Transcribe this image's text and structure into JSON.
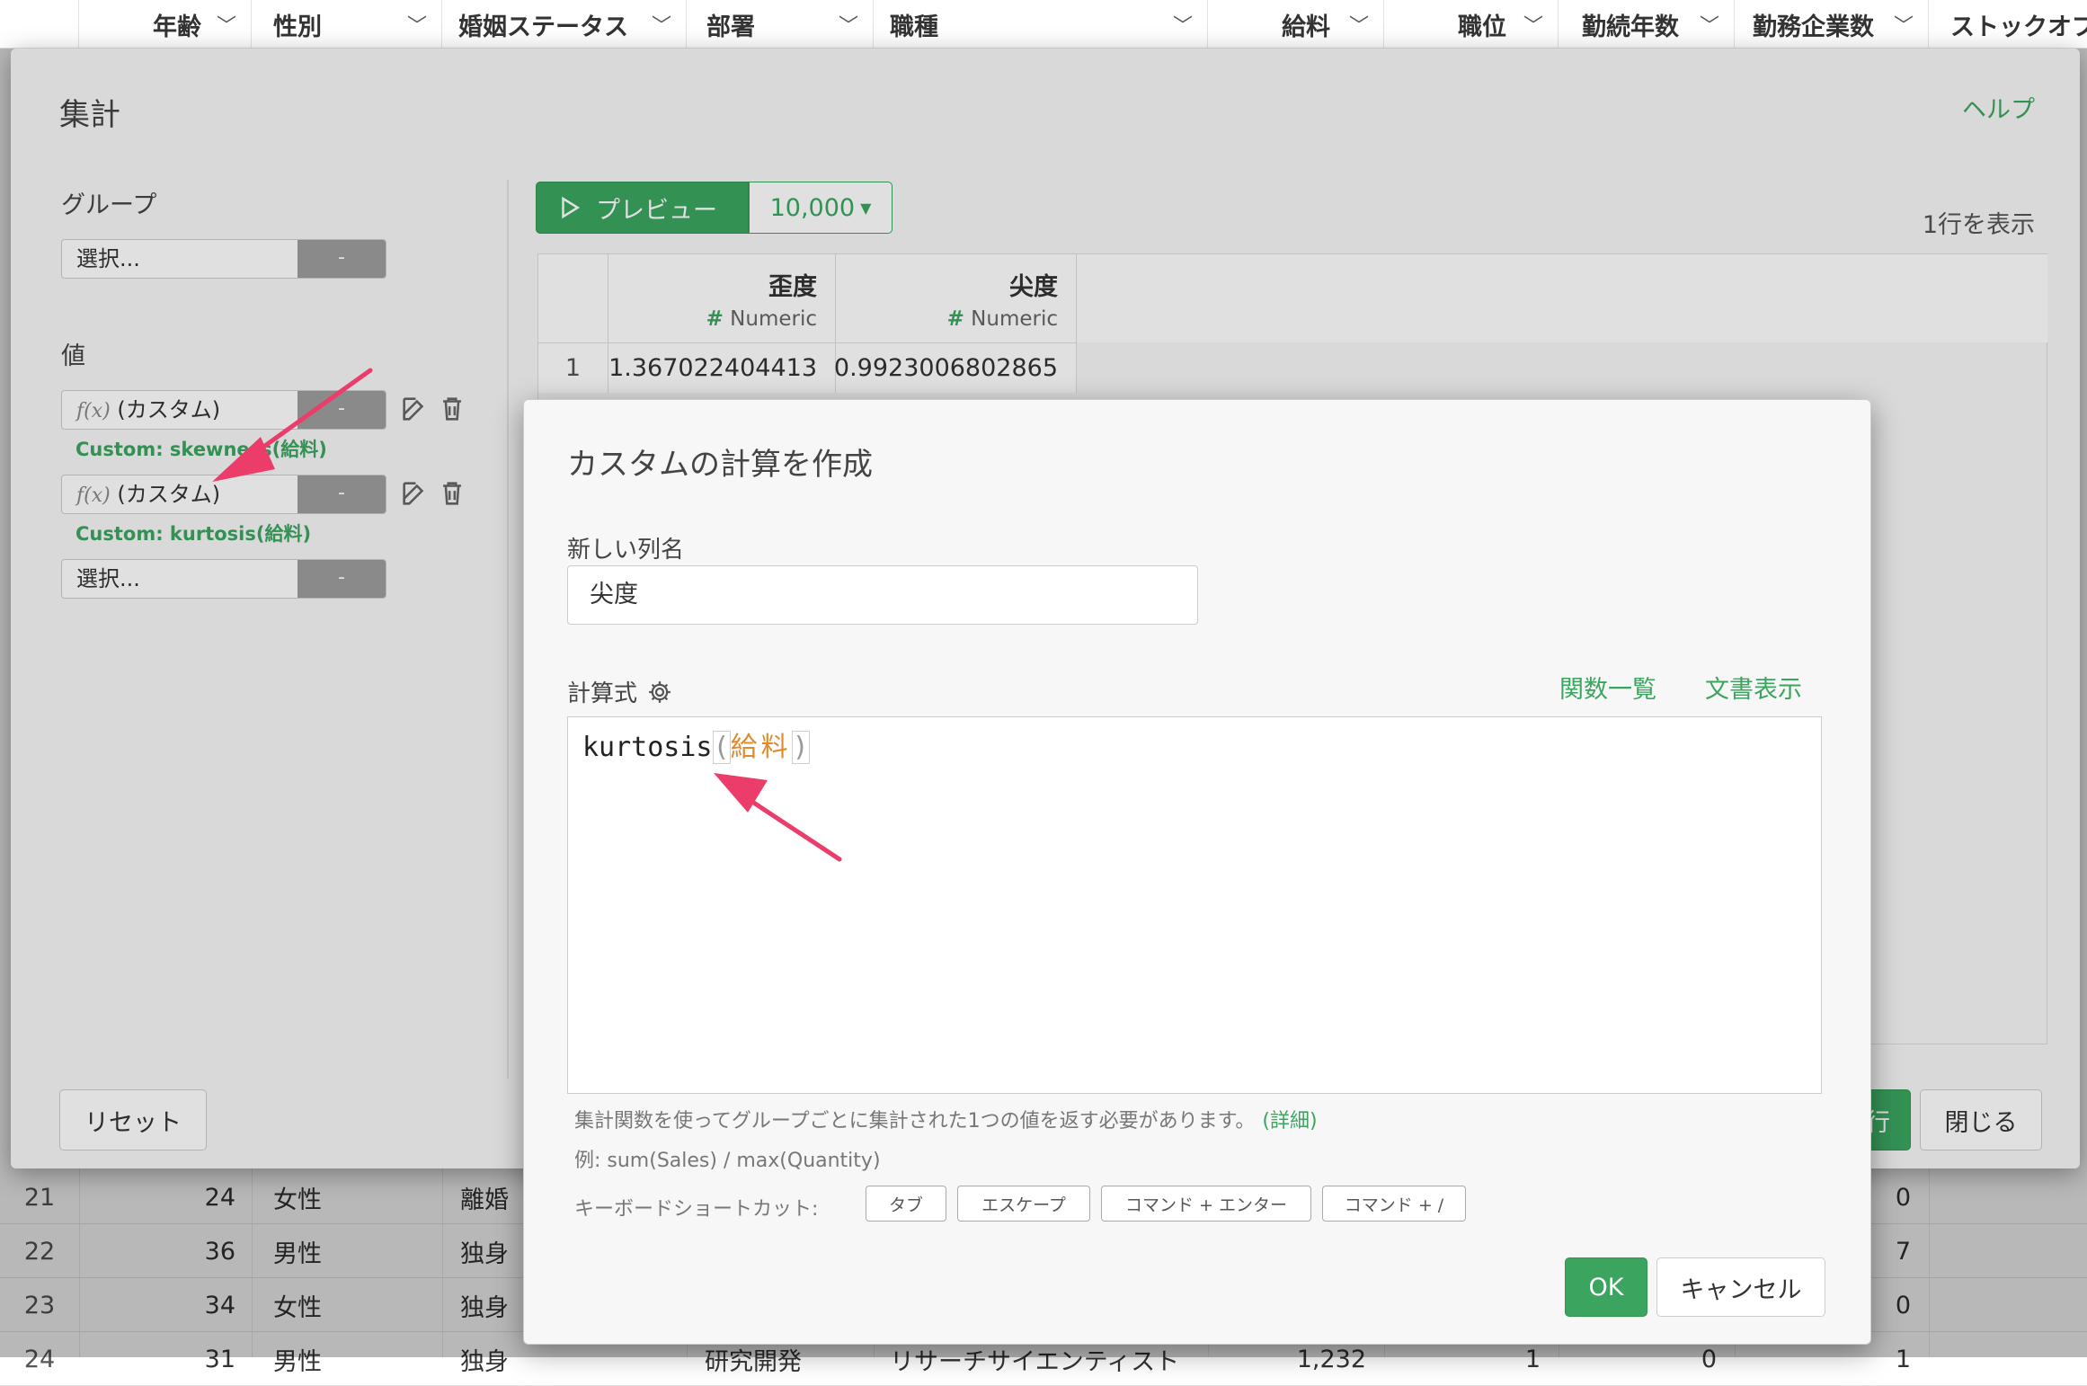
{
  "background_table": {
    "columns": [
      "年齢",
      "性別",
      "婚姻ステータス",
      "部署",
      "職種",
      "給料",
      "職位",
      "勤続年数",
      "勤務企業数",
      "ストックオプ"
    ],
    "rows": [
      {
        "num": "21",
        "age": "24",
        "sex": "女性",
        "marital": "離婚",
        "extra": "0"
      },
      {
        "num": "22",
        "age": "36",
        "sex": "男性",
        "marital": "独身",
        "extra": "7"
      },
      {
        "num": "23",
        "age": "34",
        "sex": "女性",
        "marital": "独身",
        "extra": "0"
      },
      {
        "num": "24",
        "age": "31",
        "sex": "男性",
        "marital": "独身",
        "dept": "研究開発",
        "job": "リサーチサイエンティスト",
        "salary": "1,232",
        "rank": "1",
        "years": "0",
        "extra": "1"
      }
    ]
  },
  "aggregate_dialog": {
    "title": "集計",
    "help_link": "ヘルプ",
    "group_label": "グループ",
    "group_select_placeholder": "選択...",
    "minus_label": "-",
    "value_label": "値",
    "values": [
      {
        "fx": "f(x)",
        "label": "(カスタム)",
        "caption": "Custom: skewness(給料)"
      },
      {
        "fx": "f(x)",
        "label": "(カスタム)",
        "caption": "Custom: kurtosis(給料)"
      }
    ],
    "value_select_placeholder": "選択...",
    "preview_button": "プレビュー",
    "rows_dropdown": "10,000",
    "rows_info": "1行を表示",
    "result_table": {
      "columns": [
        {
          "name": "歪度",
          "type": "Numeric"
        },
        {
          "name": "尖度",
          "type": "Numeric"
        }
      ],
      "rows": [
        {
          "index": "1",
          "values": [
            "1.367022404413",
            "0.9923006802865"
          ]
        }
      ]
    },
    "reset_button": "リセット",
    "run_button_partial": "行",
    "close_button": "閉じる"
  },
  "custom_dialog": {
    "title": "カスタムの計算を作成",
    "new_column_label": "新しい列名",
    "new_column_value": "尖度",
    "formula_label": "計算式",
    "functions_link": "関数一覧",
    "docs_link": "文書表示",
    "formula": {
      "func": "kurtosis",
      "open": "(",
      "arg": "給料",
      "close": ")"
    },
    "hint_text": "集計関数を使ってグループごとに集計された1つの値を返す必要があります。",
    "hint_link": "(詳細)",
    "example_text": "例: sum(Sales) / max(Quantity)",
    "shortcuts_label": "キーボードショートカット:",
    "shortcuts": [
      "タブ",
      "エスケープ",
      "コマンド + エンター",
      "コマンド + /"
    ],
    "ok_button": "OK",
    "cancel_button": "キャンセル"
  },
  "colors": {
    "accent_green": "#3ba560",
    "arrow_pink": "#ec3c6a",
    "code_orange": "#e08a2e"
  }
}
